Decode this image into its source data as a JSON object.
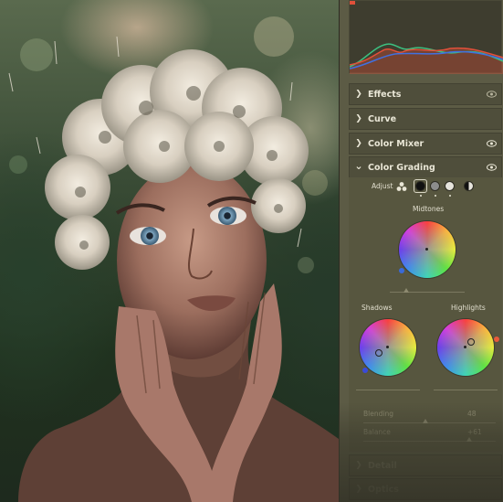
{
  "panel": {
    "sections": [
      {
        "label": "Effects",
        "collapsed": true
      },
      {
        "label": "Curve",
        "collapsed": true
      },
      {
        "label": "Color Mixer",
        "collapsed": true
      },
      {
        "label": "Color Grading",
        "collapsed": false
      },
      {
        "label": "Detail",
        "collapsed": true
      },
      {
        "label": "Optics",
        "collapsed": true
      }
    ],
    "chevron_collapsed": "❯",
    "chevron_expanded": "⌄"
  },
  "color_grading": {
    "adjust_label": "Adjust",
    "midtones_label": "Midtones",
    "shadows_label": "Shadows",
    "highlights_label": "Highlights",
    "blending_label": "Blending",
    "blending_value": "48",
    "blending_level": 0.48,
    "balance_label": "Balance",
    "balance_value": "+61",
    "balance_level": 0.8,
    "midtone_handle_color": "#3a6ad8",
    "shadow_handle_color": "#3a4ad8",
    "highlight_handle_color": "#e85a3b"
  },
  "colors": {
    "panel_bg": "#5c5b45",
    "section_bg": "#4f4e3b",
    "hist_red": "#e0503a",
    "hist_green": "#3cc080",
    "hist_blue": "#4070e0"
  },
  "icons": {
    "eye": "eye-icon",
    "chevron": "chevron-right-icon",
    "adjust_all": "three-circles-icon"
  }
}
